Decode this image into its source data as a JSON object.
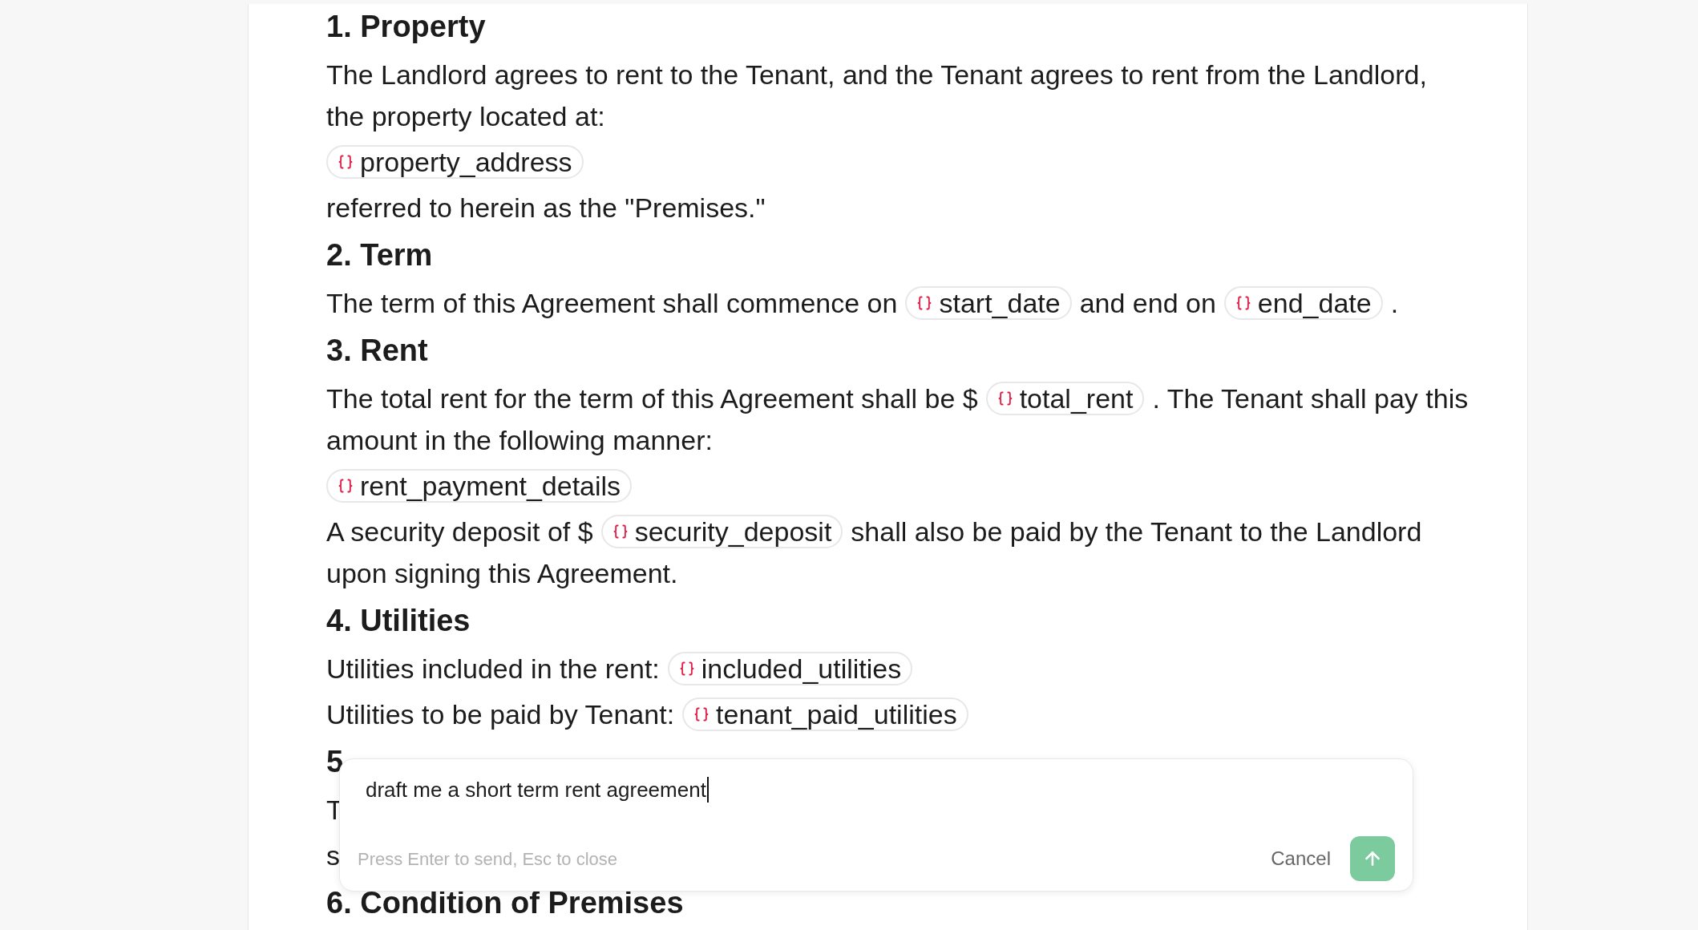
{
  "sections": [
    {
      "heading": "1. Property",
      "blocks": [
        {
          "lines": [
            [
              {
                "kind": "text",
                "text": "The Landlord agrees to rent to the Tenant, and the Tenant agrees to rent from the Landlord,"
              }
            ],
            [
              {
                "kind": "text",
                "text": "the property located at:"
              }
            ]
          ]
        },
        {
          "lines": [
            [
              {
                "kind": "variable",
                "text": "property_address"
              }
            ]
          ]
        },
        {
          "lines": [
            [
              {
                "kind": "text",
                "text": "referred to herein as the \"Premises.\""
              }
            ]
          ]
        }
      ]
    },
    {
      "heading": "2. Term",
      "blocks": [
        {
          "lines": [
            [
              {
                "kind": "text",
                "text": "The term of this Agreement shall commence on"
              },
              {
                "kind": "variable",
                "text": "start_date"
              },
              {
                "kind": "text",
                "text": "and end on"
              },
              {
                "kind": "variable",
                "text": "end_date"
              },
              {
                "kind": "text",
                "text": "."
              }
            ]
          ]
        }
      ]
    },
    {
      "heading": "3. Rent",
      "blocks": [
        {
          "lines": [
            [
              {
                "kind": "text",
                "text": "The total rent for the term of this Agreement shall be $"
              },
              {
                "kind": "variable",
                "text": "total_rent"
              },
              {
                "kind": "text",
                "text": ". The Tenant shall pay this"
              }
            ],
            [
              {
                "kind": "text",
                "text": "amount in the following manner:"
              }
            ]
          ]
        },
        {
          "lines": [
            [
              {
                "kind": "variable",
                "text": "rent_payment_details"
              }
            ]
          ]
        },
        {
          "lines": [
            [
              {
                "kind": "text",
                "text": "A security deposit of $"
              },
              {
                "kind": "variable",
                "text": "security_deposit"
              },
              {
                "kind": "text",
                "text": "shall also be paid by the Tenant to the Landlord"
              }
            ],
            [
              {
                "kind": "text",
                "text": "upon signing this Agreement."
              }
            ]
          ]
        }
      ]
    },
    {
      "heading": "4. Utilities",
      "blocks": [
        {
          "lines": [
            [
              {
                "kind": "text",
                "text": "Utilities included in the rent:"
              },
              {
                "kind": "variable",
                "text": "included_utilities"
              }
            ]
          ]
        },
        {
          "lines": [
            [
              {
                "kind": "text",
                "text": "Utilities to be paid by Tenant:"
              },
              {
                "kind": "variable",
                "text": "tenant_paid_utilities"
              }
            ]
          ]
        }
      ]
    },
    {
      "heading": "5",
      "blocks": [
        {
          "lines": [
            [
              {
                "kind": "text",
                "text": "T"
              }
            ]
          ]
        },
        {
          "lines": [
            [
              {
                "kind": "text",
                "text": "s"
              }
            ]
          ]
        }
      ]
    },
    {
      "heading": "6. Condition of Premises"
    }
  ],
  "prompt": {
    "value": "draft me a short term rent agreement",
    "hint": "Press Enter to send, Esc to close",
    "cancel": "Cancel"
  }
}
